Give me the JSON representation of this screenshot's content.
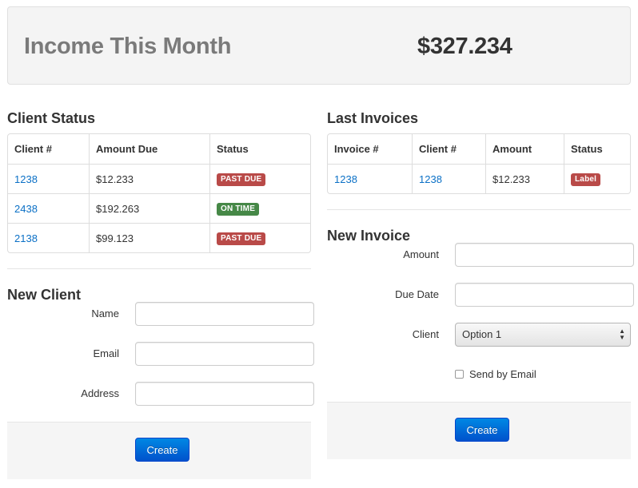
{
  "hero": {
    "title": "Income This Month",
    "amount": "$327.234"
  },
  "client_status": {
    "title": "Client Status",
    "columns": [
      "Client #",
      "Amount Due",
      "Status"
    ],
    "rows": [
      {
        "client": "1238",
        "amount_due": "$12.233",
        "status": "PAST DUE"
      },
      {
        "client": "2438",
        "amount_due": "$192.263",
        "status": "ON TIME"
      },
      {
        "client": "2138",
        "amount_due": "$99.123",
        "status": "PAST DUE"
      }
    ]
  },
  "last_invoices": {
    "title": "Last Invoices",
    "columns": [
      "Invoice #",
      "Client #",
      "Amount",
      "Status"
    ],
    "rows": [
      {
        "invoice": "1238",
        "client": "1238",
        "amount": "$12.233",
        "status": "Label"
      }
    ]
  },
  "new_client": {
    "title": "New Client",
    "name_label": "Name",
    "email_label": "Email",
    "address_label": "Address",
    "name_value": "",
    "email_value": "",
    "address_value": "",
    "create_label": "Create"
  },
  "new_invoice": {
    "title": "New Invoice",
    "amount_label": "Amount",
    "due_date_label": "Due Date",
    "client_label": "Client",
    "client_selected": "Option 1",
    "send_email_label": "Send by Email",
    "send_email_checked": false,
    "create_label": "Create"
  },
  "colors": {
    "link": "#0b70c6",
    "danger": "#b94a48",
    "success": "#468847",
    "primary": "#0066cc"
  }
}
